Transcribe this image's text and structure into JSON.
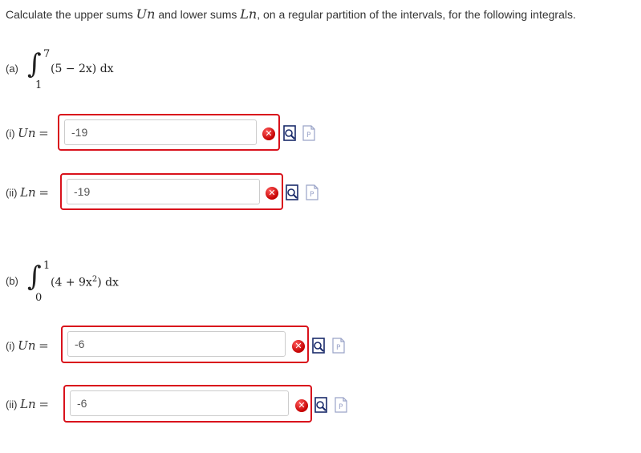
{
  "prompt": {
    "before": "Calculate the upper sums ",
    "upper_symbol": "Un",
    "middle": " and lower sums ",
    "lower_symbol": "Ln",
    "after": ", on a regular partition of the intervals, for the following integrals."
  },
  "parts": [
    {
      "label": "(a)",
      "upper_limit": "7",
      "lower_limit": "1",
      "integrand": "(5 − 2x) dx",
      "answers": [
        {
          "label": "(i)",
          "symbol": "Un",
          "equals": "=",
          "value": "-19",
          "status": "incorrect",
          "status_icon": "x-icon"
        },
        {
          "label": "(ii)",
          "symbol": "Ln",
          "equals": "=",
          "value": "-19",
          "status": "incorrect",
          "status_icon": "x-icon"
        }
      ]
    },
    {
      "label": "(b)",
      "upper_limit": "1",
      "lower_limit": "0",
      "integrand_main": "(4 + 9x",
      "integrand_sup": "2",
      "integrand_tail": ") dx",
      "answers": [
        {
          "label": "(i)",
          "symbol": "Un",
          "equals": "=",
          "value": "-6",
          "status": "incorrect",
          "status_icon": "x-icon"
        },
        {
          "label": "(ii)",
          "symbol": "Ln",
          "equals": "=",
          "value": "-6",
          "status": "incorrect",
          "status_icon": "x-icon"
        }
      ]
    }
  ],
  "colors": {
    "incorrect_border": "#d9121c",
    "incorrect_icon": "#c40000",
    "text": "#333333"
  }
}
